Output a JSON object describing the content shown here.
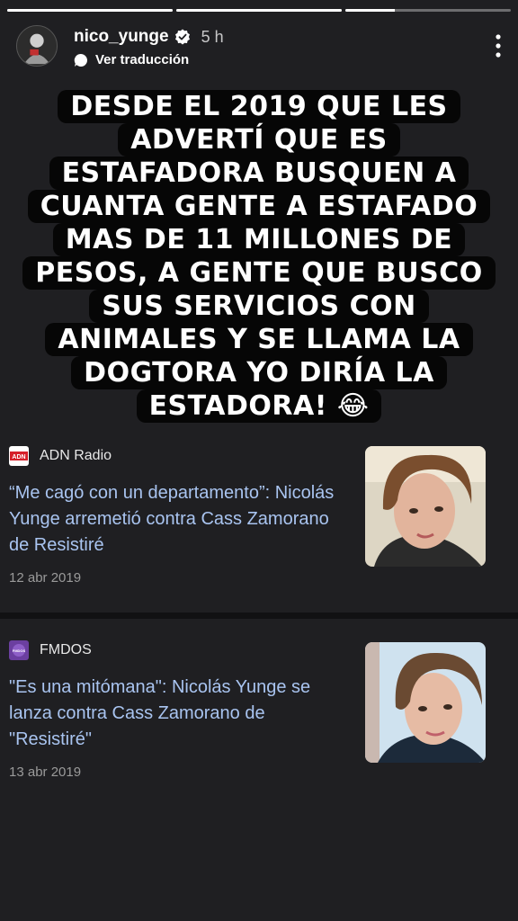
{
  "story": {
    "progress": [
      1,
      1,
      0.3
    ]
  },
  "header": {
    "username": "nico_yunge",
    "time": "5 h",
    "translate_label": "Ver traducción",
    "verified_color": "#ffffff"
  },
  "caption": {
    "lines": [
      "DESDE EL 2019 QUE LES",
      "ADVERTÍ QUE ES",
      "ESTAFADORA BUSQUEN A",
      "CUANTA GENTE A ESTAFADO",
      "MAS DE 11 MILLONES DE",
      "PESOS, A GENTE QUE BUSCO",
      "SUS SERVICIOS CON",
      "ANIMALES Y SE LLAMA LA",
      "DOGTORA YO DIRÍA LA",
      "ESTADORA! 😂"
    ]
  },
  "cards": [
    {
      "source": "ADN Radio",
      "logo_text": "ADN",
      "headline": "“Me cagó con un departamento”: Nicolás Yunge arremetió contra Cass Zamorano de Resistiré",
      "date": "12 abr 2019"
    },
    {
      "source": "FMDOS",
      "logo_text": "FMDOS",
      "headline": "\"Es una mitómana\": Nicolás Yunge se lanza contra Cass Zamorano de \"Resistiré\"",
      "date": "13 abr 2019"
    }
  ],
  "colors": {
    "background": "#1f1f22",
    "link": "#a9c4f0",
    "caption_bg": "#060606"
  }
}
